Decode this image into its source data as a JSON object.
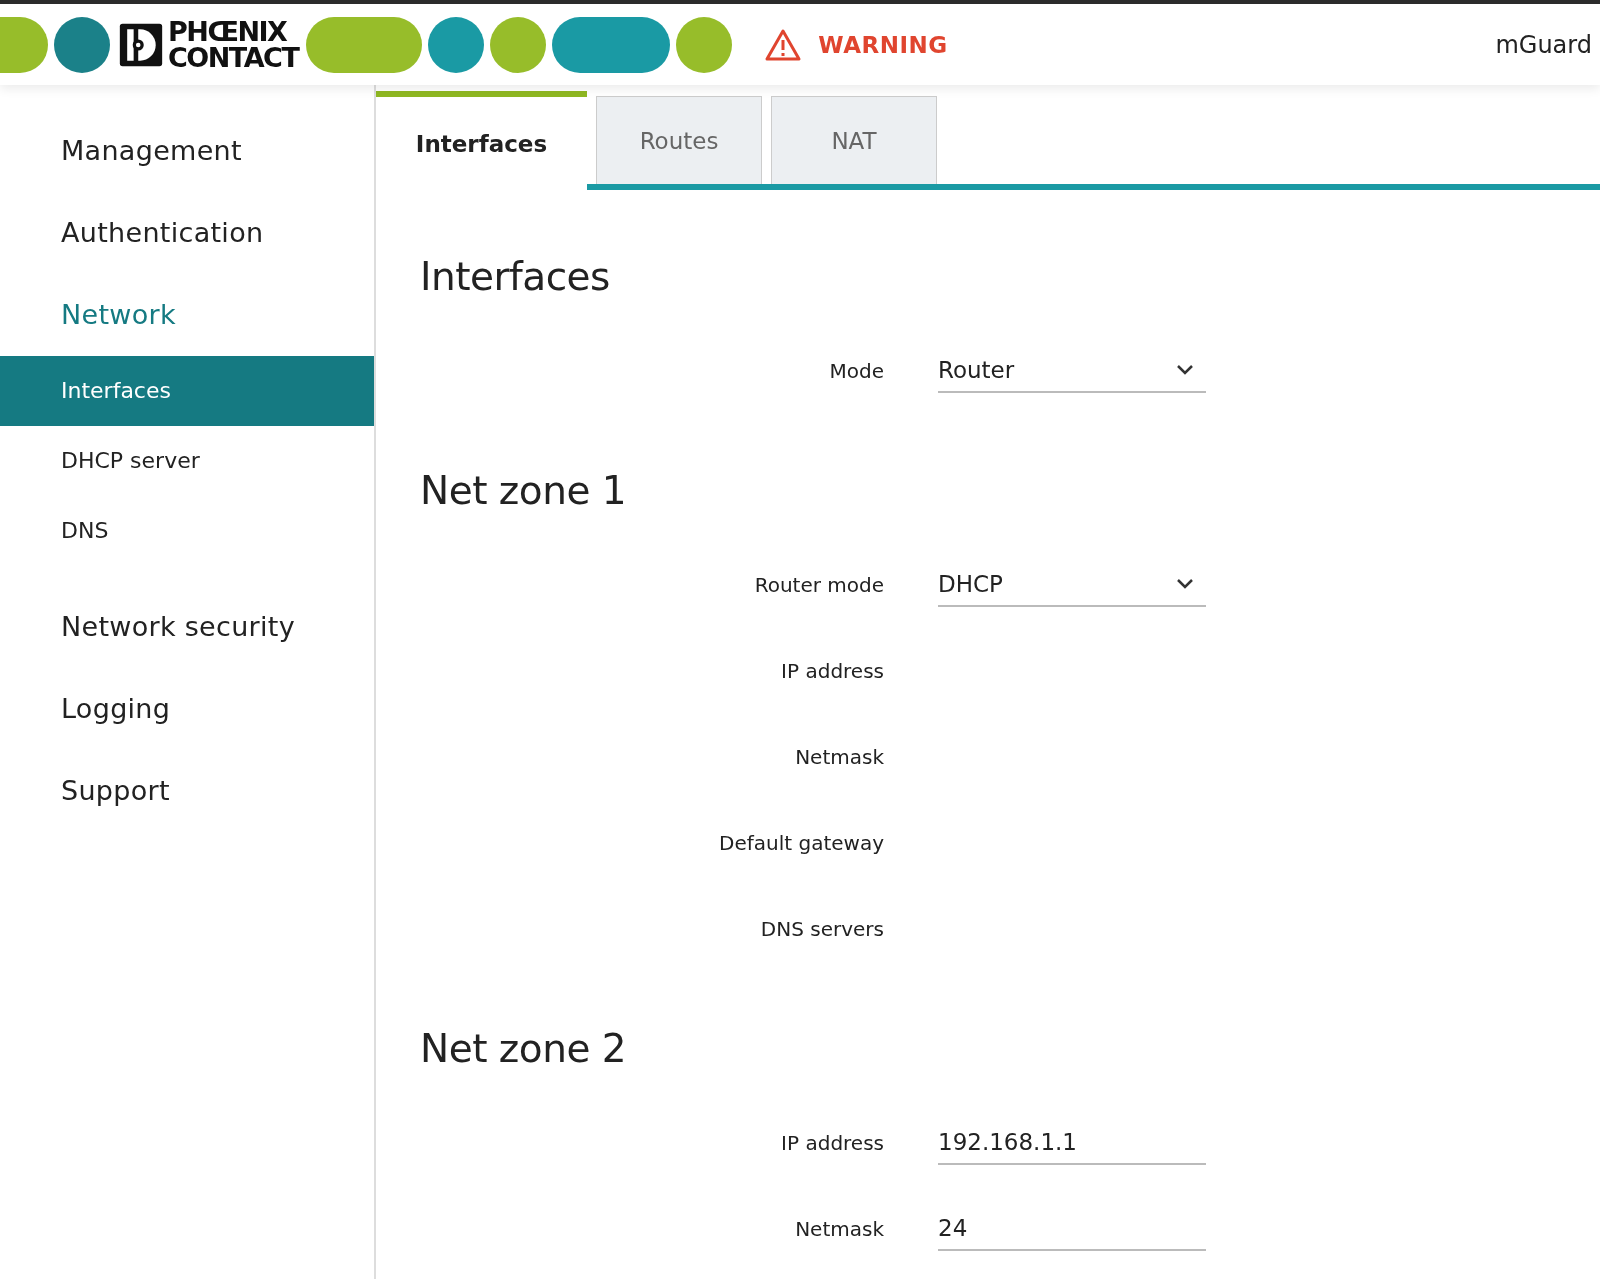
{
  "header": {
    "logo": {
      "line_1": "PHŒNIX",
      "line_2": "CONTACT"
    },
    "warning": "WARNING",
    "product": "mGuard"
  },
  "sidebar": {
    "groups": [
      {
        "title": "Management",
        "selected": false
      },
      {
        "title": "Authentication",
        "selected": false
      },
      {
        "title": "Network",
        "selected": true,
        "children": [
          {
            "label": "Interfaces",
            "selected": true
          },
          {
            "label": "DHCP server",
            "selected": false
          },
          {
            "label": "DNS",
            "selected": false
          }
        ]
      },
      {
        "title": "Network security",
        "selected": false
      },
      {
        "title": "Logging",
        "selected": false
      },
      {
        "title": "Support",
        "selected": false
      }
    ]
  },
  "tabs": [
    {
      "label": "Interfaces",
      "selected": true
    },
    {
      "label": "Routes",
      "selected": false
    },
    {
      "label": "NAT",
      "selected": false
    }
  ],
  "sections": [
    {
      "title": "Interfaces",
      "rows": [
        {
          "label": "Mode",
          "kind": "select",
          "value": "Router"
        }
      ]
    },
    {
      "title": "Net zone 1",
      "rows": [
        {
          "label": "Router mode",
          "kind": "select",
          "value": "DHCP"
        },
        {
          "label": "IP address",
          "kind": "plain"
        },
        {
          "label": "Netmask",
          "kind": "plain"
        },
        {
          "label": "Default gateway",
          "kind": "plain"
        },
        {
          "label": "DNS servers",
          "kind": "plain"
        }
      ]
    },
    {
      "title": "Net zone 2",
      "rows": [
        {
          "label": "IP address",
          "kind": "input",
          "value": "192.168.1.1"
        },
        {
          "label": "Netmask",
          "kind": "input",
          "value": "24"
        }
      ]
    }
  ]
}
